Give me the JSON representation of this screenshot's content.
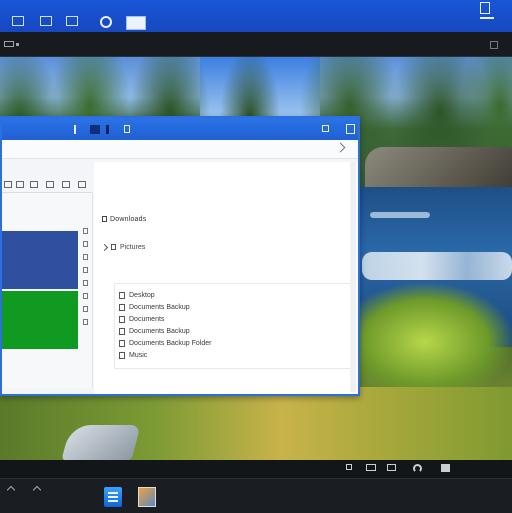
{
  "topbar": {
    "icons": [
      "tab-icon",
      "tab-icon",
      "tab-icon",
      "circle-icon",
      "active-window-icon",
      "notification-icon"
    ]
  },
  "explorer": {
    "titlebar_icons": [
      "flag-icon",
      "folder-icon",
      "pin-icon",
      "document-icon",
      "close-icon",
      "maximize-icon"
    ],
    "toolbar_icons": [
      "back-icon",
      "forward-icon",
      "up-icon",
      "view-icon",
      "sort-icon",
      "more-icon"
    ],
    "folder_header": "Downloads",
    "tree_items": [
      {
        "label": "Pictures",
        "collapsed": true
      },
      {
        "label": "",
        "collapsed": false
      }
    ],
    "files": [
      {
        "name": "Desktop"
      },
      {
        "name": "Documents Backup"
      },
      {
        "name": "Documents"
      },
      {
        "name": "Documents Backup"
      },
      {
        "name": "Documents Backup Folder"
      },
      {
        "name": "Music"
      }
    ],
    "preview_tiles": [
      {
        "color": "#2f4f9f"
      },
      {
        "color": "#119a22"
      }
    ]
  },
  "taskbar": {
    "apps": [
      "notes-app-icon",
      "gallery-app-icon"
    ],
    "tray_icons": [
      "flag-icon",
      "monitor-icon",
      "keyboard-icon",
      "wifi-icon",
      "speaker-icon"
    ]
  }
}
